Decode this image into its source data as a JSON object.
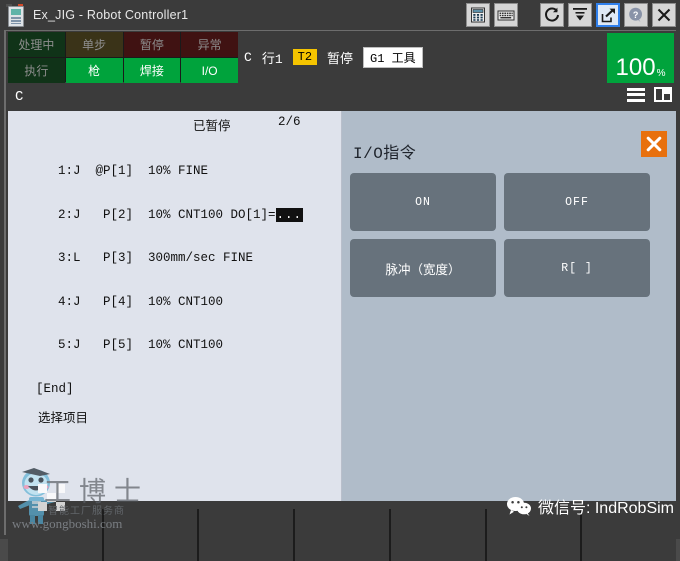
{
  "titlebar": {
    "title": "Ex_JIG - Robot Controller1",
    "app_icon": "teach-pendant-icon",
    "buttons": [
      {
        "name": "calculator-icon",
        "glyph": "calculator"
      },
      {
        "name": "keyboard-icon",
        "glyph": "keyboard"
      },
      {
        "name": "reset-icon",
        "glyph": "circular-arrow"
      },
      {
        "name": "collapse-icon",
        "glyph": "arrow-to-line"
      },
      {
        "name": "restore-icon",
        "glyph": "arrow-out-of-box",
        "selected": true
      },
      {
        "name": "help-icon",
        "glyph": "question-mark"
      },
      {
        "name": "close-icon",
        "glyph": "x"
      }
    ]
  },
  "status": {
    "row1": [
      {
        "label": "处理中",
        "state": "off-green"
      },
      {
        "label": "单步",
        "state": "off-olive"
      },
      {
        "label": "暂停",
        "state": "off-red"
      },
      {
        "label": "异常",
        "state": "off-red"
      }
    ],
    "row2": [
      {
        "label": "执行",
        "state": "off-green"
      },
      {
        "label": "枪",
        "state": "on"
      },
      {
        "label": "焊接",
        "state": "on"
      },
      {
        "label": "I/O",
        "state": "on"
      }
    ],
    "mode_char": "C",
    "line_label": "行1",
    "teach_mode": "T2",
    "run_state": "暂停",
    "tool_label": "G1 工具",
    "override_value": "100",
    "override_unit": "%",
    "override_color": "#00a33c"
  },
  "menurow": {
    "label": "C",
    "menu_icon": "hamburger-menu-icon",
    "layout_icon": "split-pane-icon"
  },
  "program": {
    "status_text": "已暂停",
    "line_count": "2/6",
    "lines": [
      "1:J  @P[1]  10% FINE",
      "2:J   P[2]  10% CNT100 DO[1]=",
      "3:L   P[3]  300mm/sec FINE",
      "4:J   P[4]  10% CNT100",
      "5:J   P[5]  10% CNT100"
    ],
    "cursor_text": "...",
    "end_marker": "[End]",
    "footer_prompt": "选择项目"
  },
  "io_panel": {
    "title": "I/O指令",
    "close_icon": "close-x-icon",
    "close_color": "#e8700d",
    "buttons": [
      {
        "label": "ON",
        "cjk": false
      },
      {
        "label": "OFF",
        "cjk": false
      },
      {
        "label": "脉冲（宽度）",
        "cjk": true
      },
      {
        "label": "R[ ]",
        "cjk": false
      }
    ]
  },
  "softkeys": {
    "count": 7,
    "labels": [
      "",
      "",
      "",
      "",
      "",
      "",
      ""
    ]
  },
  "watermark": {
    "brand_cn": "工博士",
    "brand_sub": "智能工厂服务商",
    "url": "www.gongboshi.com",
    "mascot_icon": "robot-mascot-icon",
    "wechat_icon": "wechat-icon",
    "wechat_text": "微信号: IndRobSim"
  }
}
